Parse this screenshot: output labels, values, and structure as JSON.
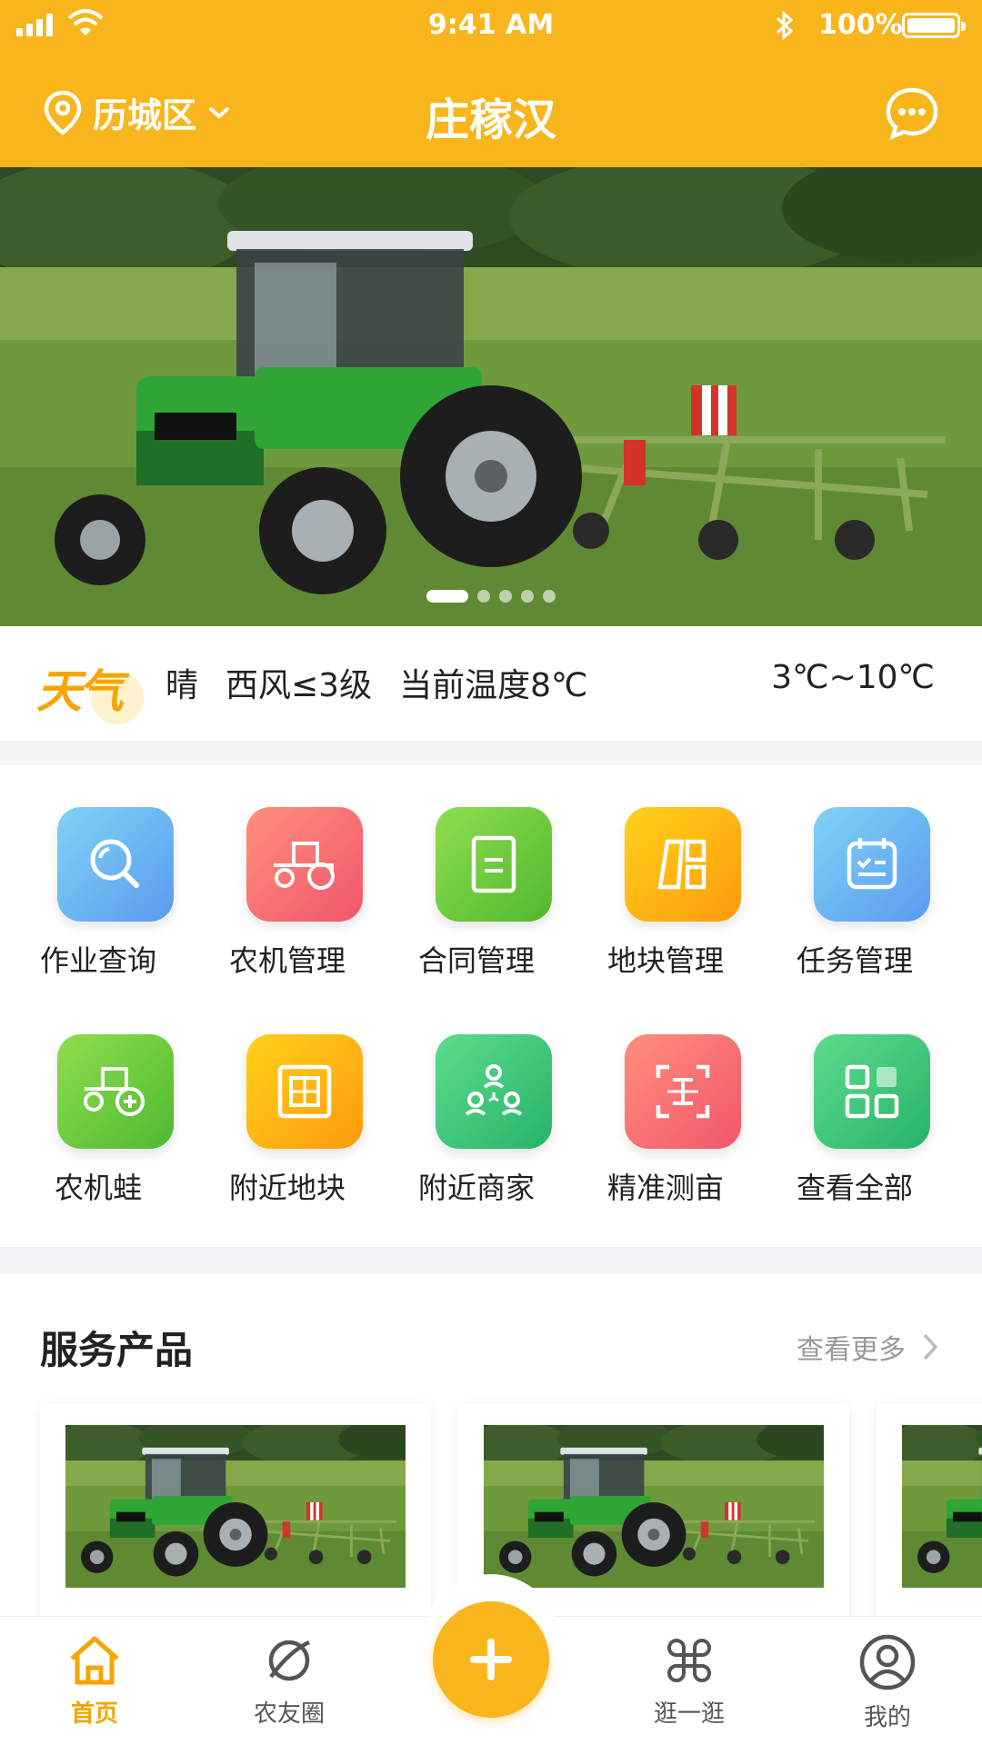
{
  "status_bar": {
    "time": "9:41 AM",
    "battery": "100%"
  },
  "header": {
    "location": "历城区",
    "title": "庄稼汉"
  },
  "banner": {
    "slide_count": 5,
    "active_slide": 1
  },
  "weather": {
    "logo_text": "天气",
    "condition": "晴",
    "wind": "西风≤3级",
    "current": "当前温度8℃",
    "range": "3℃~10℃"
  },
  "grid": {
    "items": [
      {
        "label": "作业查询",
        "icon": "search-icon"
      },
      {
        "label": "农机管理",
        "icon": "tractor-icon"
      },
      {
        "label": "合同管理",
        "icon": "document-icon"
      },
      {
        "label": "地块管理",
        "icon": "field-blocks-icon"
      },
      {
        "label": "任务管理",
        "icon": "calendar-icon"
      },
      {
        "label": "农机蛙",
        "icon": "tractor-plus-icon"
      },
      {
        "label": "附近地块",
        "icon": "plot-icon"
      },
      {
        "label": "附近商家",
        "icon": "merchants-icon"
      },
      {
        "label": "精准测亩",
        "icon": "measure-icon"
      },
      {
        "label": "查看全部",
        "icon": "all-apps-icon"
      }
    ]
  },
  "products": {
    "title": "服务产品",
    "more": "查看更多"
  },
  "tabbar": {
    "tabs": [
      {
        "label": "首页",
        "icon": "home-icon"
      },
      {
        "label": "农友圈",
        "icon": "planet-icon"
      },
      {
        "label": "逛一逛",
        "icon": "command-icon"
      },
      {
        "label": "我的",
        "icon": "user-icon"
      }
    ],
    "active": "首页"
  },
  "colors": {
    "brand": "#f8b51c",
    "accent_text": "#f7a400"
  }
}
